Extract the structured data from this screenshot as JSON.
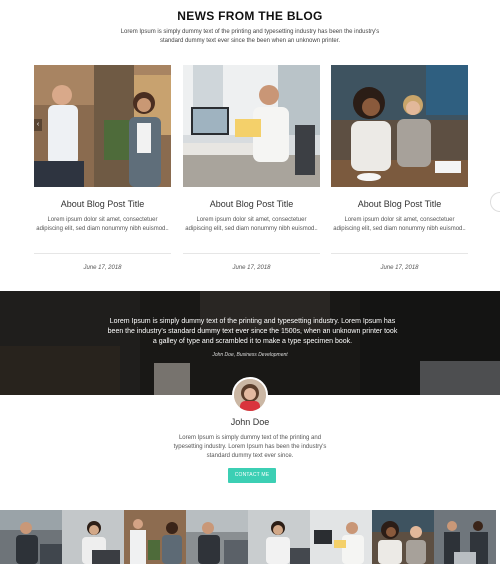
{
  "blog": {
    "title": "NEWS FROM THE BLOG",
    "intro": "Lorem Ipsum is simply dummy text of the printing and typesetting industry has been the industry's standard dummy text ever since the been when an unknown printer.",
    "posts": [
      {
        "title": "About Blog Post Title",
        "excerpt": "Lorem ipsum dolor sit amet, consectetuer adipiscing elit, sed diam nonummy nibh euismod..",
        "date": "June 17, 2018",
        "image": "two-colleagues-coffee-photo"
      },
      {
        "title": "About Blog Post Title",
        "excerpt": "Lorem ipsum dolor sit amet, consectetuer adipiscing elit, sed diam nonummy nibh euismod..",
        "date": "June 17, 2018",
        "image": "man-reading-at-desk-photo"
      },
      {
        "title": "About Blog Post Title",
        "excerpt": "Lorem ipsum dolor sit amet, consectetuer adipiscing elit, sed diam nonummy nibh euismod..",
        "date": "June 17, 2018",
        "image": "women-laughing-meeting-photo"
      }
    ]
  },
  "testimonial": {
    "quote": "Lorem Ipsum is simply dummy text of the printing and typesetting industry. Lorem Ipsum has been the industry's standard dummy text ever since the 1500s, when an unknown printer took a galley of type and scrambled it to make a type specimen book.",
    "author": "John Doe, Business Development"
  },
  "profile": {
    "name": "John Doe",
    "text": "Lorem Ipsum is simply dummy text of the printing and typesetting industry. Lorem Ipsum has been the industry's standard dummy text ever since.",
    "button": "CONTACT ME"
  },
  "colors": {
    "accent": "#3ccfb4",
    "heading": "#111111",
    "dark_band": "#2b2a28"
  },
  "icons": {
    "prev": "chevron-left-icon",
    "scroll": "scroll-handle-icon"
  },
  "gallery": [
    "office-team-photo",
    "woman-laptop-photo",
    "man-reading-photo",
    "colleagues-meeting-photo",
    "woman-writing-photo",
    "team-desk-photo",
    "woman-laughing-photo",
    "business-people-photo"
  ]
}
